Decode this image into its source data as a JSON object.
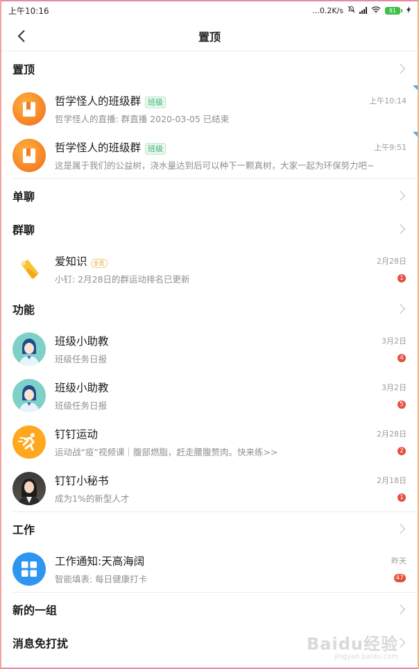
{
  "status_bar": {
    "time": "上午10:16",
    "speed": "...0.2K/s",
    "battery": "81"
  },
  "nav": {
    "title": "置顶"
  },
  "sections": {
    "pinned": "置顶",
    "single": "单聊",
    "group": "群聊",
    "function": "功能",
    "work": "工作",
    "new_group": "新的一组",
    "dnd": "消息免打扰"
  },
  "pinned_rows": [
    {
      "name": "哲学怪人的班级群",
      "tag": "班级",
      "time": "上午10:14",
      "sub": "哲学怪人的直播: 群直播 2020-03-05 已结束"
    },
    {
      "name": "哲学怪人的班级群",
      "tag": "班级",
      "time": "上午9:51",
      "sub": "这是属于我们的公益树，浇水量达到后可以种下一颗真树，大家一起为环保努力吧~"
    }
  ],
  "group_rows": [
    {
      "name": "爱知识",
      "tag": "全员",
      "time": "2月28日",
      "sub": "小钉: 2月28日的群运动排名已更新",
      "badge": "1"
    }
  ],
  "function_rows": [
    {
      "name": "班级小助教",
      "time": "3月2日",
      "sub": "班级任务日报",
      "badge": "4"
    },
    {
      "name": "班级小助教",
      "time": "3月2日",
      "sub": "班级任务日报",
      "badge": "5"
    },
    {
      "name": "钉钉运动",
      "time": "2月28日",
      "sub": "运动战“疫”视频课｜腹部燃脂，赶走腰腹赘肉。快来练>>",
      "badge": "2"
    },
    {
      "name": "钉钉小秘书",
      "time": "2月18日",
      "sub": "成为1%的新型人才",
      "badge": "1"
    }
  ],
  "work_rows": [
    {
      "name": "工作通知:天高海阔",
      "time": "昨天",
      "sub": "智能填表: 每日健康打卡",
      "badge": "47"
    }
  ],
  "watermark": {
    "main": "Baidu经验",
    "sub": "jingyan.baidu.com"
  },
  "colors": {
    "accent_blue": "#2e95f0",
    "badge_red": "#e5503d",
    "tag_green": "#3bb56f",
    "divider": "#ececec"
  }
}
